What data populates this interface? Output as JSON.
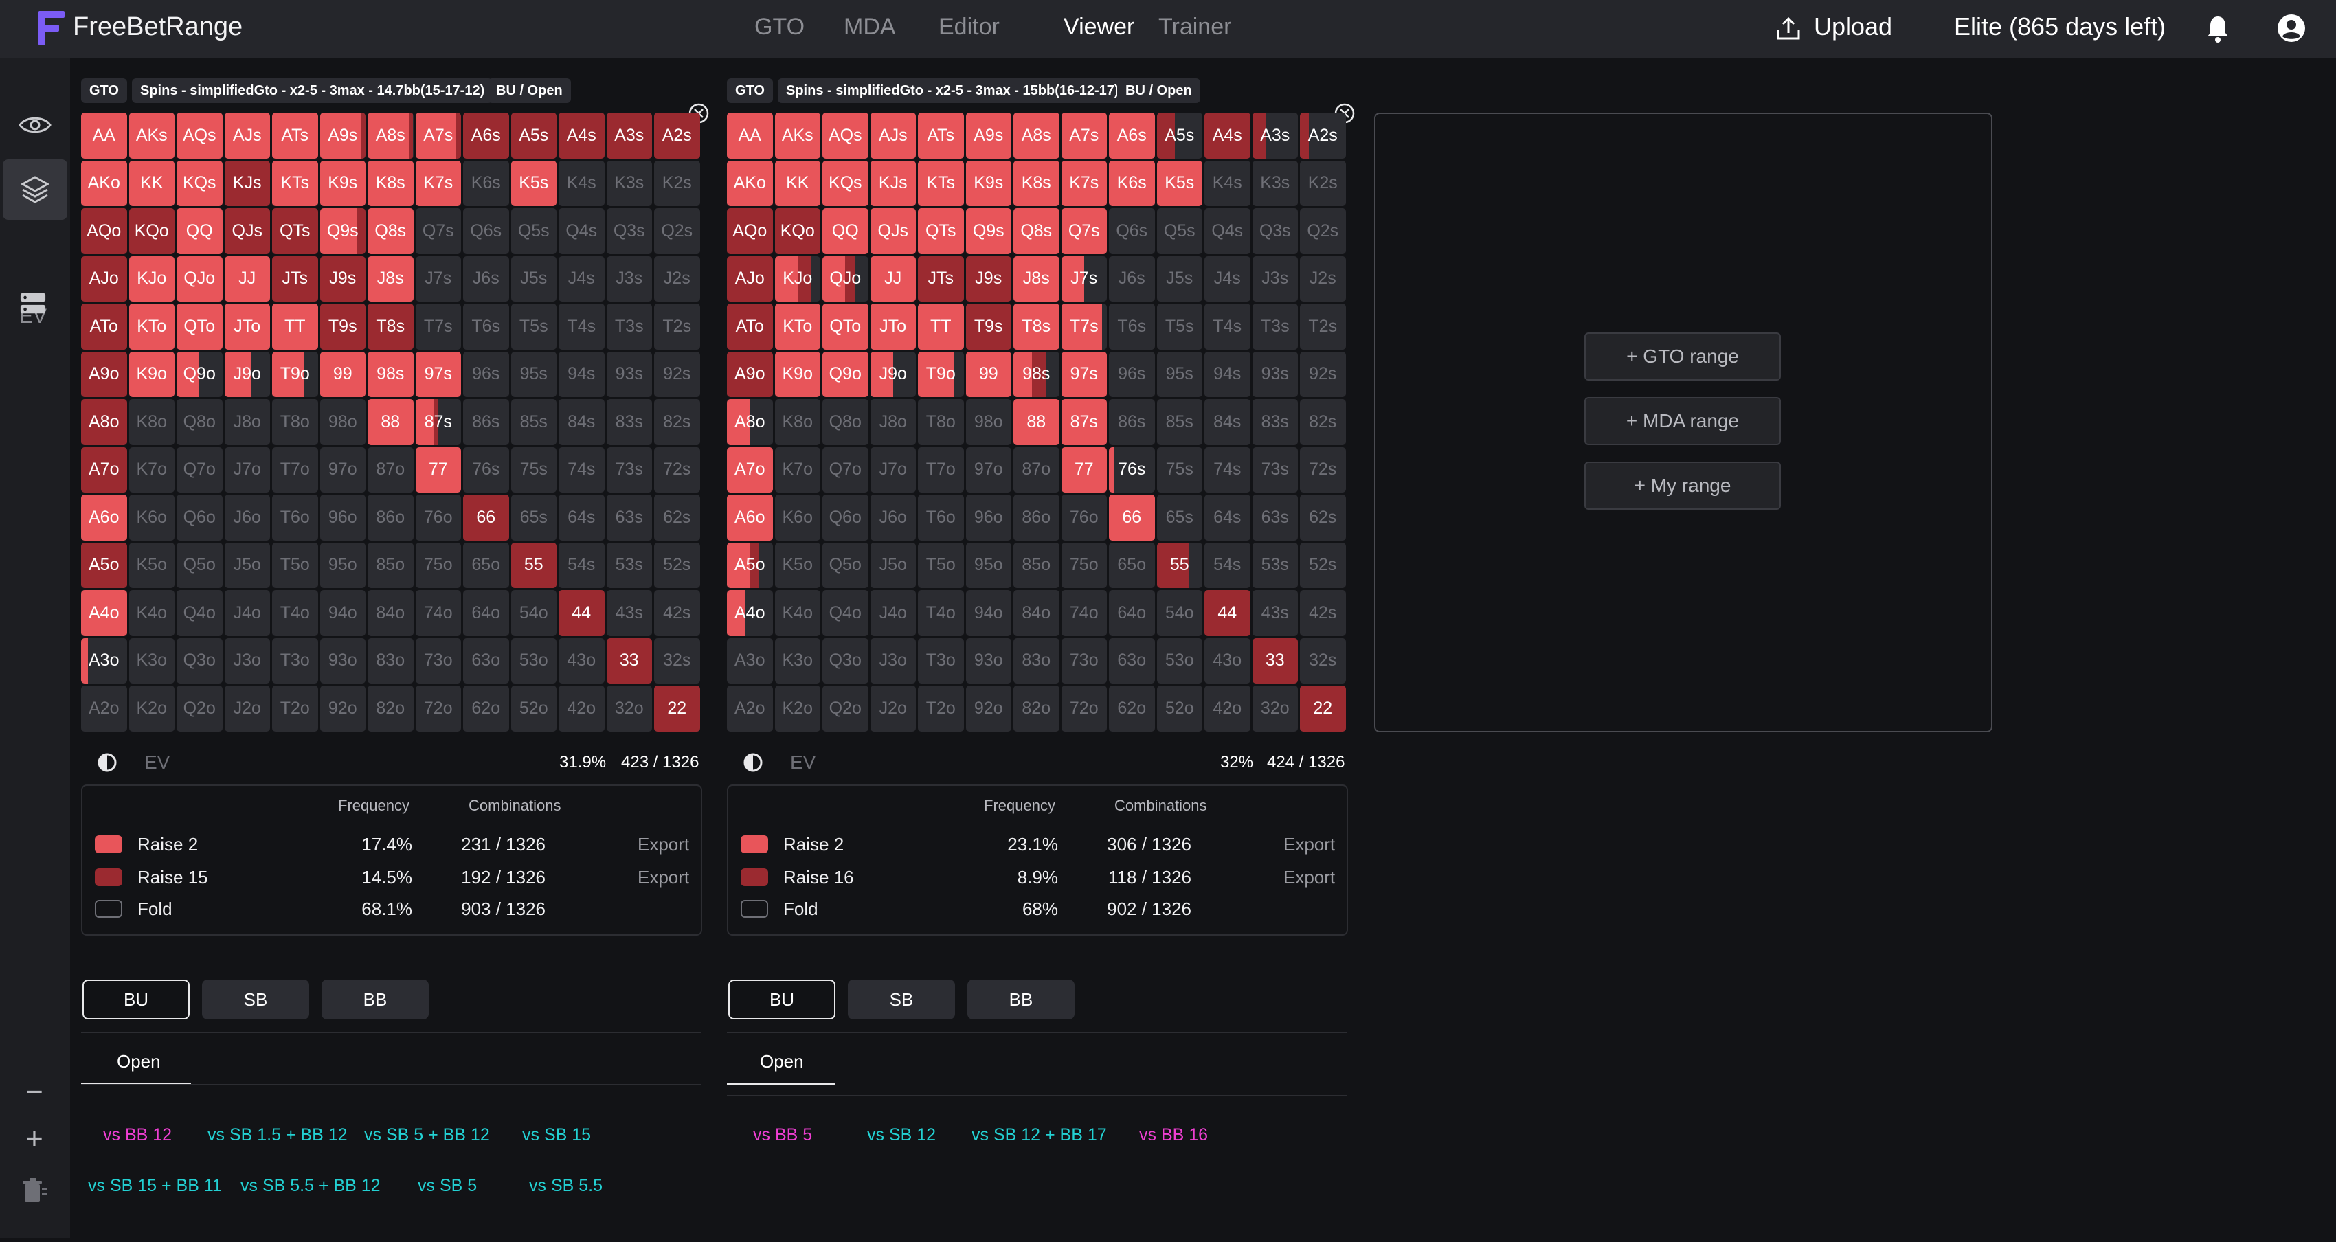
{
  "app": {
    "brand": "FreeBetRange",
    "brand_color": "#7b5cf5"
  },
  "nav": [
    "GTO",
    "MDA",
    "Editor",
    "Viewer",
    "Trainer"
  ],
  "nav_active": "Viewer",
  "header": {
    "upload_label": "Upload",
    "plan_label": "Elite (865 days left)"
  },
  "rail": {
    "ev_label": "EV",
    "minus": "−",
    "plus": "+"
  },
  "colors": {
    "raise_small": "#e8555a",
    "raise_big": "#9b2a30",
    "fold": "#2b2c31"
  },
  "panels": [
    {
      "tags": [
        "GTO",
        "Spins - simplifiedGto - x2-5 - 3max - 14.7bb(15-17-12)",
        "BU / Open"
      ],
      "ev": {
        "label": "EV",
        "percent": "31.9%",
        "combos": "423 / 1326"
      },
      "stats": {
        "headers": {
          "frequency": "Frequency",
          "combinations": "Combinations"
        },
        "rows": [
          {
            "name": "Raise 2",
            "freq": "17.4%",
            "combos": "231 / 1326",
            "export": "Export",
            "color": "#e8555a"
          },
          {
            "name": "Raise 15",
            "freq": "14.5%",
            "combos": "192 / 1326",
            "export": "Export",
            "color": "#9b2a30"
          },
          {
            "name": "Fold",
            "freq": "68.1%",
            "combos": "903 / 1326",
            "export": "",
            "color": ""
          }
        ]
      },
      "positions": [
        "BU",
        "SB",
        "BB"
      ],
      "action_tab": "Open",
      "vs_row1": [
        {
          "label": "vs BB 12",
          "color": "pink"
        },
        {
          "label": "vs SB 1.5 + BB 12",
          "color": "cyan"
        },
        {
          "label": "vs SB 5 + BB 12",
          "color": "cyan"
        },
        {
          "label": "vs SB 15",
          "color": "cyan"
        }
      ],
      "vs_row2": [
        {
          "label": "vs SB 15 + BB 11",
          "color": "cyan"
        },
        {
          "label": "vs SB 5.5 + BB 12",
          "color": "cyan"
        },
        {
          "label": "vs SB 5",
          "color": "cyan"
        },
        {
          "label": "vs SB 5.5",
          "color": "cyan"
        }
      ],
      "hands": [
        "2:0:0.2",
        "2:0:0.2",
        "2:0:0.2",
        "2:0:0.2",
        "2:0:0.2",
        "1:0:0.1",
        "1:0:0.1",
        "1:0:0.1",
        "0:1",
        "0:1",
        "0:1",
        "0:1",
        "0:1",
        "2:0:0.2",
        "2:0:0.2",
        "2:0:0.2",
        "0:1",
        "2:0.2:0.2",
        "2:0:0.2",
        "2:0:0.2",
        "1:0:0",
        "F",
        "1:0:0",
        "F",
        "F",
        "F",
        "0:1",
        "0:1",
        "2:0:0.2",
        "0:1",
        "0:1",
        "1:0:0.2",
        "2:0:0.2",
        "F",
        "F",
        "F",
        "F",
        "F",
        "F",
        "0:1",
        "2:0.1:0.1",
        "2:0:0.2",
        "2:0:0.2",
        "0:1",
        "0:1",
        "2:0:0.2",
        "F",
        "F",
        "F",
        "F",
        "F",
        "F",
        "0:1",
        "2:0:0.2",
        "2:0:0.2",
        "2:0:0.2",
        "2:0:0.2",
        "0:1",
        "0:1",
        "F",
        "F",
        "F",
        "F",
        "F",
        "F",
        "0:1",
        "2:0:0.2",
        "1:0.5:0",
        "0.6:0",
        "1:0.3:0",
        "2:0:0.2",
        "2:0:0.2",
        "1:0:0",
        "F",
        "F",
        "F",
        "F",
        "F",
        "0:1",
        "F",
        "F",
        "F",
        "F",
        "F",
        "2:0:0.2",
        "1:0.5:0.1",
        "F",
        "F",
        "F",
        "F",
        "F",
        "0:1",
        "F",
        "F",
        "F",
        "F",
        "F",
        "F",
        "2:0:0.2",
        "F",
        "F",
        "F",
        "F",
        "F",
        "2:0:0.2",
        "F",
        "F",
        "F",
        "F",
        "F",
        "F",
        "F",
        "0:1",
        "F",
        "F",
        "F",
        "F",
        "0:1",
        "F",
        "F",
        "F",
        "F",
        "F",
        "F",
        "F",
        "F",
        "0:1",
        "F",
        "F",
        "F",
        "2:0:0.2",
        "F",
        "F",
        "F",
        "F",
        "F",
        "F",
        "F",
        "F",
        "F",
        "0:1",
        "F",
        "F",
        "0.15:0",
        "F",
        "F",
        "F",
        "F",
        "F",
        "F",
        "F",
        "F",
        "F",
        "F",
        "0:1",
        "F",
        "F",
        "F",
        "F",
        "F",
        "F",
        "F",
        "F",
        "F",
        "F",
        "F",
        "F",
        "F",
        "0:1"
      ]
    },
    {
      "tags": [
        "GTO",
        "Spins - simplifiedGto - x2-5 - 3max - 15bb(16-12-17)",
        "BU / Open"
      ],
      "ev": {
        "label": "EV",
        "percent": "32%",
        "combos": "424 / 1326"
      },
      "stats": {
        "headers": {
          "frequency": "Frequency",
          "combinations": "Combinations"
        },
        "rows": [
          {
            "name": "Raise 2",
            "freq": "23.1%",
            "combos": "306 / 1326",
            "export": "Export",
            "color": "#e8555a"
          },
          {
            "name": "Raise 16",
            "freq": "8.9%",
            "combos": "118 / 1326",
            "export": "Export",
            "color": "#9b2a30"
          },
          {
            "name": "Fold",
            "freq": "68%",
            "combos": "902 / 1326",
            "export": "",
            "color": ""
          }
        ]
      },
      "positions": [
        "BU",
        "SB",
        "BB"
      ],
      "action_tab": "Open",
      "vs_row1": [
        {
          "label": "vs BB 5",
          "color": "pink"
        },
        {
          "label": "vs SB 12",
          "color": "cyan"
        },
        {
          "label": "vs SB 12 + BB 17",
          "color": "cyan"
        },
        {
          "label": "vs BB 16",
          "color": "pink"
        }
      ],
      "vs_row2": [],
      "hands": [
        "2:0:0.2",
        "2:0:0.2",
        "2:0:0.2",
        "2:0:0.2",
        "2:0:0.2",
        "2:0:0.2",
        "2:0:0.2",
        "2:0:0.2",
        "2:0:0.2",
        "1:0.6:0.4",
        "0:1",
        "1:0.7:0.3",
        "1:0.8:0.2",
        "2:0:0.2",
        "2:0:0.2",
        "2:0:0.2",
        "2:0:0.2",
        "2:0.3:0.2",
        "2:0:0.2",
        "2:0:0.2",
        "2:0:0.2",
        "2:0:0.2",
        "2:0:0.2",
        "F",
        "F",
        "F",
        "0:1",
        "0:1",
        "2:0:0.2",
        "2:0:0.2",
        "2:0.3:0.2",
        "2:0:0.2",
        "2:0:0.2",
        "2:0:0.2",
        "F",
        "F",
        "F",
        "F",
        "F",
        "0:1",
        "1:0.2:0.3",
        "1:0.3:0.2",
        "2:0:0.2",
        "0:1",
        "0:1",
        "2:0:0.2",
        "1:0.5:0",
        "F",
        "F",
        "F",
        "F",
        "F",
        "0:1",
        "2:0:0.2",
        "2:0:0.2",
        "2:0:0.2",
        "2:0:0.2",
        "0:1",
        "2:0:0.2",
        "1:0.1:0",
        "F",
        "F",
        "F",
        "F",
        "F",
        "0:1",
        "2:0:0.2",
        "2:0:0.2",
        "1:0.5:0",
        "1:0.2:0",
        "2:0:0.2",
        "1:0.3:0.3",
        "2:0:0.2",
        "F",
        "F",
        "F",
        "F",
        "F",
        "1:0.5:0",
        "F",
        "F",
        "F",
        "F",
        "F",
        "2:0:0.2",
        "2:0:0.2",
        "F",
        "F",
        "F",
        "F",
        "F",
        "2:0:0.2",
        "F",
        "F",
        "F",
        "F",
        "F",
        "F",
        "2:0:0.2",
        "0.1:0",
        "F",
        "F",
        "F",
        "F",
        "2:0:0.2",
        "F",
        "F",
        "F",
        "F",
        "F",
        "F",
        "F",
        "2:0:0.2",
        "F",
        "F",
        "F",
        "F",
        "1:0.3:0.2",
        "F",
        "F",
        "F",
        "F",
        "F",
        "F",
        "F",
        "F",
        "1:0.3:0.7",
        "F",
        "F",
        "F",
        "0.4:0",
        "F",
        "F",
        "F",
        "F",
        "F",
        "F",
        "F",
        "F",
        "F",
        "0:1",
        "F",
        "F",
        "F",
        "F",
        "F",
        "F",
        "F",
        "F",
        "F",
        "F",
        "F",
        "F",
        "F",
        "0:1",
        "F",
        "F",
        "F",
        "F",
        "F",
        "F",
        "F",
        "F",
        "F",
        "F",
        "F",
        "F",
        "F",
        "0:1"
      ]
    }
  ],
  "compare": {
    "buttons": [
      "+ GTO range",
      "+ MDA range",
      "+ My range"
    ]
  }
}
